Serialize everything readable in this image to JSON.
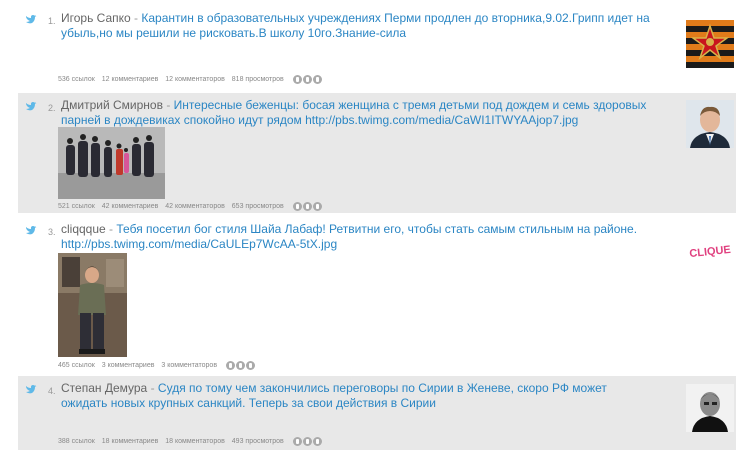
{
  "posts": [
    {
      "number": "1.",
      "author": "Игорь Сапко",
      "separator": "-",
      "text": "Карантин в образовательных учреждениях Перми продлен до вторника,9.02.Грипп идет на убыль,но мы решили не рисковать.В школу 10го.Знание-сила",
      "stats": [
        "536 ссылок",
        "12 комментариев",
        "12 комментаторов",
        "818 просмотров"
      ]
    },
    {
      "number": "2.",
      "author": "Дмитрий Смирнов",
      "separator": "-",
      "text": "Интересные беженцы: босая женщина с тремя детьми под дождем и семь здоровых парней в дождевиках спокойно идут рядом http://pbs.twimg.com/media/CaWI1ITWYAAjop7.jpg",
      "stats": [
        "521 ссылок",
        "42 комментариев",
        "42 комментаторов",
        "653 просмотров"
      ]
    },
    {
      "number": "3.",
      "author": "cliqqque",
      "separator": "-",
      "text": "Тебя посетил бог стиля Шайа Лабаф! Ретвитни его, чтобы стать самым стильным на районе. http://pbs.twimg.com/media/CaULEp7WcAA-5tX.jpg",
      "stats": [
        "465 ссылок",
        "3 комментариев",
        "3 комментаторов"
      ],
      "avatar_text": "CLIQUE"
    },
    {
      "number": "4.",
      "author": "Степан Демура",
      "separator": "-",
      "text": "Судя по тому чем закончились переговоры по Сирии в Женеве, скоро РФ может ожидать новых крупных санкций. Теперь за свои действия в Сирии",
      "stats": [
        "388 ссылок",
        "18 комментариев",
        "18 комментаторов",
        "493 просмотров"
      ]
    }
  ],
  "colors": {
    "link": "#2b86c4",
    "shaded_row": "#e8e8e8",
    "twitter_icon": "#5fb9e8",
    "clique_logo": "#e0407f"
  },
  "icons": [
    "twitter-bird-icon",
    "share-icon"
  ]
}
